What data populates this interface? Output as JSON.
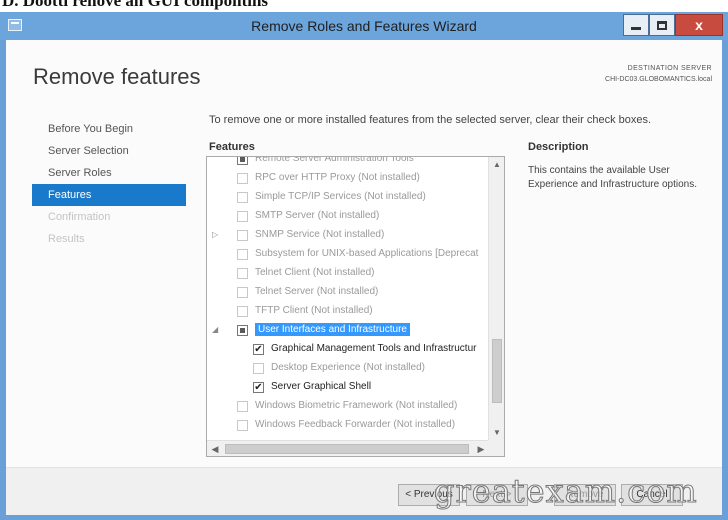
{
  "caption": "D. Dootti renove an GUI compontins",
  "window": {
    "title": "Remove Roles and Features Wizard"
  },
  "page": {
    "heading": "Remove features",
    "destination_label": "DESTINATION SERVER",
    "destination_server": "CHI-DC03.GLOBOMANTICS.local",
    "instruction": "To remove one or more installed features from the selected server, clear their check boxes.",
    "features_title": "Features",
    "description_title": "Description",
    "description_text": "This contains the available User Experience and Infrastructure options."
  },
  "nav": {
    "items": [
      {
        "label": "Before You Begin",
        "state": "normal"
      },
      {
        "label": "Server Selection",
        "state": "normal"
      },
      {
        "label": "Server Roles",
        "state": "normal"
      },
      {
        "label": "Features",
        "state": "active"
      },
      {
        "label": "Confirmation",
        "state": "disabled"
      },
      {
        "label": "Results",
        "state": "disabled"
      }
    ]
  },
  "features": [
    {
      "label": "Remote Server Administration Tools",
      "checked": "partial",
      "installed": false,
      "expander": "",
      "indent": 0
    },
    {
      "label": "RPC over HTTP Proxy (Not installed)",
      "checked": "none",
      "installed": false,
      "expander": "",
      "indent": 0
    },
    {
      "label": "Simple TCP/IP Services (Not installed)",
      "checked": "none",
      "installed": false,
      "expander": "",
      "indent": 0
    },
    {
      "label": "SMTP Server (Not installed)",
      "checked": "none",
      "installed": false,
      "expander": "",
      "indent": 0
    },
    {
      "label": "SNMP Service (Not installed)",
      "checked": "none",
      "installed": false,
      "expander": "▷",
      "indent": 0
    },
    {
      "label": "Subsystem for UNIX-based Applications [Deprecat",
      "checked": "none",
      "installed": false,
      "expander": "",
      "indent": 0
    },
    {
      "label": "Telnet Client (Not installed)",
      "checked": "none",
      "installed": false,
      "expander": "",
      "indent": 0
    },
    {
      "label": "Telnet Server (Not installed)",
      "checked": "none",
      "installed": false,
      "expander": "",
      "indent": 0
    },
    {
      "label": "TFTP Client (Not installed)",
      "checked": "none",
      "installed": false,
      "expander": "",
      "indent": 0
    },
    {
      "label": "User Interfaces and Infrastructure",
      "checked": "partial",
      "installed": true,
      "expander": "◢",
      "indent": 0,
      "selected": true
    },
    {
      "label": "Graphical Management Tools and Infrastructur",
      "checked": "checked",
      "installed": true,
      "expander": "",
      "indent": 1
    },
    {
      "label": "Desktop Experience (Not installed)",
      "checked": "none",
      "installed": false,
      "expander": "",
      "indent": 1
    },
    {
      "label": "Server Graphical Shell",
      "checked": "checked",
      "installed": true,
      "expander": "",
      "indent": 1
    },
    {
      "label": "Windows Biometric Framework (Not installed)",
      "checked": "none",
      "installed": false,
      "expander": "",
      "indent": 0
    },
    {
      "label": "Windows Feedback Forwarder (Not installed)",
      "checked": "none",
      "installed": false,
      "expander": "",
      "indent": 0
    }
  ],
  "buttons": {
    "previous": "< Previous",
    "next": "Next >",
    "remove": "Remove",
    "cancel": "Cancel"
  },
  "watermark": "greatexam.com",
  "icons": {
    "check": "✔",
    "scroll_up": "▲",
    "scroll_down": "▼",
    "scroll_left": "◀",
    "scroll_right": "▶",
    "close": "x"
  },
  "colors": {
    "titlebar": "#6ca4dc",
    "nav_active": "#1979ca",
    "selection": "#3399ff",
    "close_button": "#c74b3e"
  }
}
